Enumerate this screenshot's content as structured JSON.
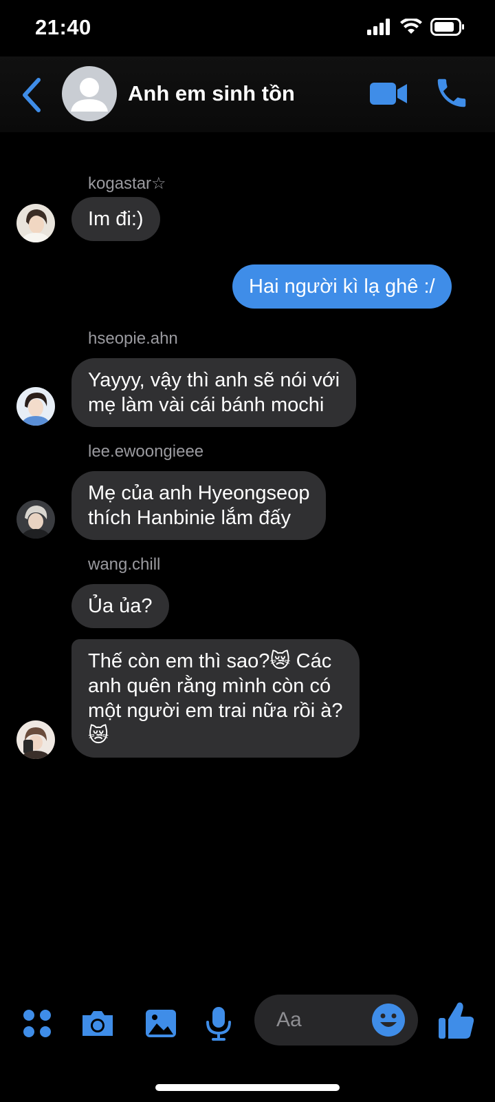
{
  "status_bar": {
    "time": "21:40"
  },
  "header": {
    "title": "Anh em sinh tồn"
  },
  "messages": [
    {
      "sender": "kogastar☆",
      "text": "Im đi:)"
    },
    {
      "outgoing": true,
      "text": "Hai người kì lạ ghê :/"
    },
    {
      "sender": "hseopie.ahn",
      "lines": [
        "Yayyy, vậy thì anh sẽ nói với",
        "mẹ làm vài cái bánh mochi"
      ]
    },
    {
      "sender": "lee.ewoongieee",
      "lines": [
        "Mẹ của anh Hyeongseop",
        "thích Hanbinie lắm đấy"
      ]
    },
    {
      "sender": "wang.chill",
      "text": "Ủa ủa?"
    },
    {
      "lines": [
        "Thế còn em thì sao?😿 Các",
        "anh quên rằng mình còn có",
        "một người em trai nữa rồi à?",
        "😿"
      ]
    }
  ],
  "composer": {
    "placeholder": "Aa"
  },
  "colors": {
    "accent": "#3f8de8",
    "incoming_bubble": "#303032",
    "background": "#000000"
  },
  "icons": [
    "back-chevron-icon",
    "video-call-icon",
    "phone-icon",
    "apps-grid-icon",
    "camera-icon",
    "gallery-icon",
    "microphone-icon",
    "emoji-icon",
    "like-thumbs-up-icon"
  ]
}
